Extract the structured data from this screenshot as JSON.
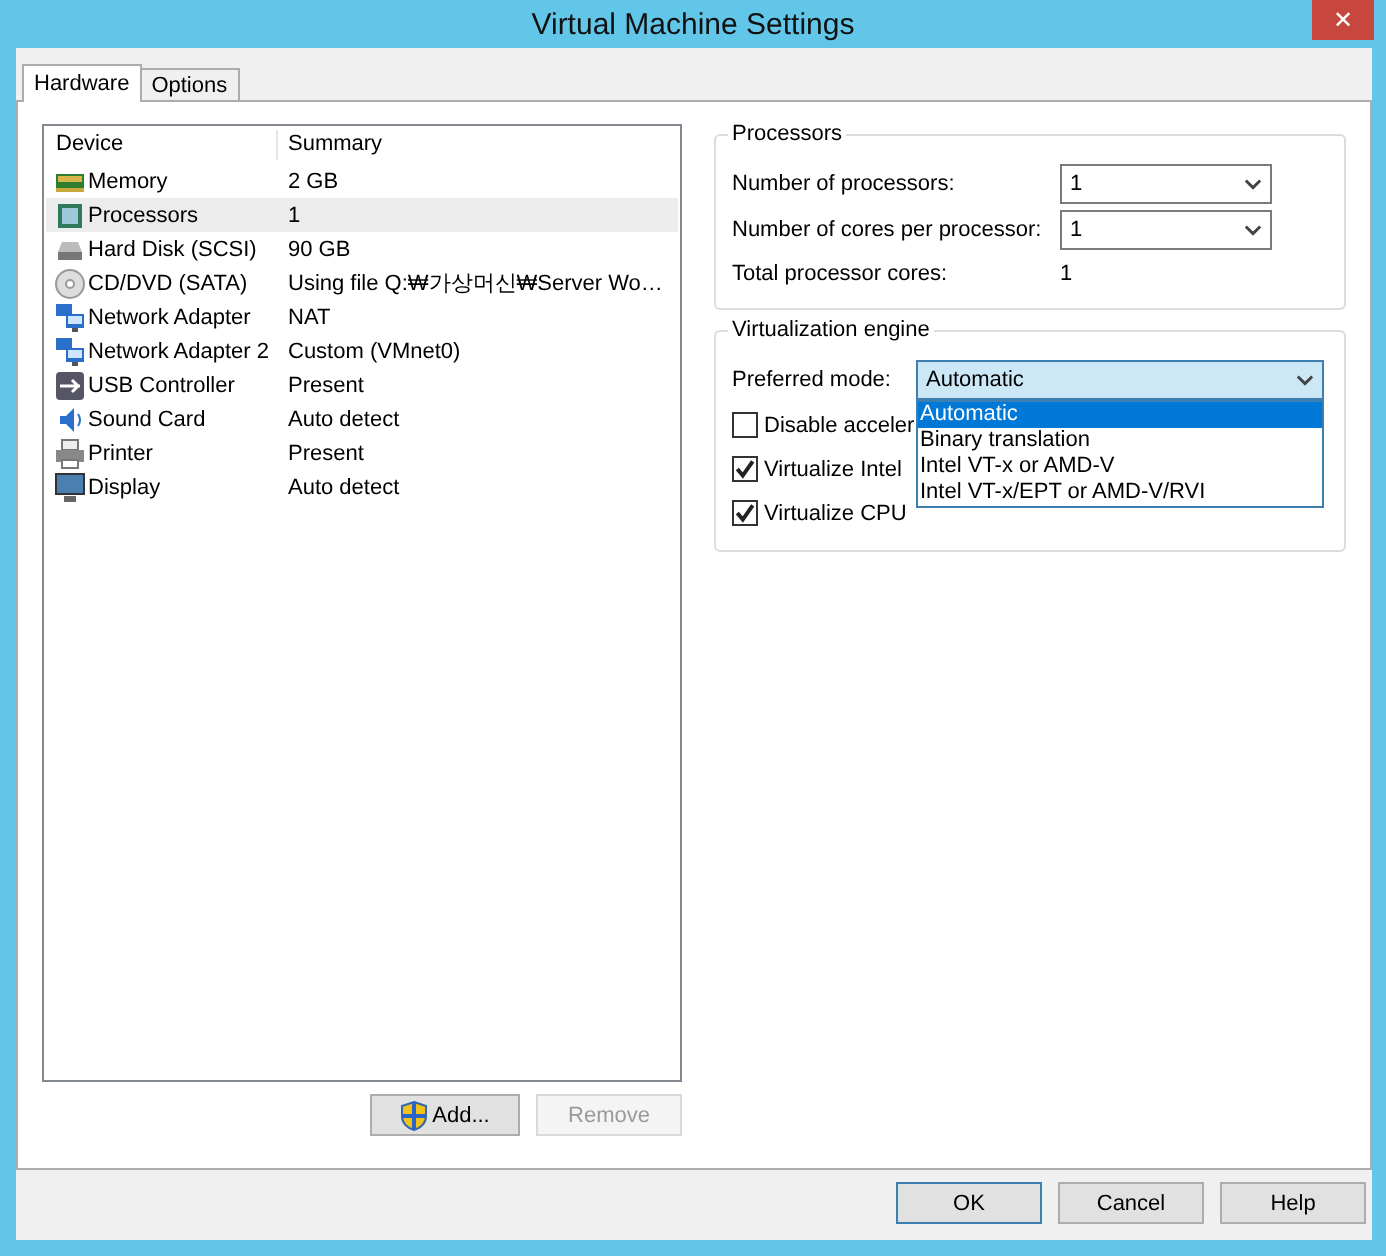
{
  "window": {
    "title": "Virtual Machine Settings",
    "close": "✕"
  },
  "tabs": [
    {
      "label": "Hardware",
      "selected": true
    },
    {
      "label": "Options",
      "selected": false
    }
  ],
  "devices": {
    "columns": [
      "Device",
      "Summary"
    ],
    "rows": [
      {
        "kind": "memory",
        "device": "Memory",
        "summary": "2 GB",
        "selected": false
      },
      {
        "kind": "processor",
        "device": "Processors",
        "summary": "1",
        "selected": true
      },
      {
        "kind": "disk",
        "device": "Hard Disk (SCSI)",
        "summary": "90 GB",
        "selected": false
      },
      {
        "kind": "cd",
        "device": "CD/DVD (SATA)",
        "summary": "Using file Q:₩가상머신₩Server Wo…",
        "selected": false
      },
      {
        "kind": "network",
        "device": "Network Adapter",
        "summary": "NAT",
        "selected": false
      },
      {
        "kind": "network",
        "device": "Network Adapter 2",
        "summary": "Custom (VMnet0)",
        "selected": false
      },
      {
        "kind": "usb",
        "device": "USB Controller",
        "summary": "Present",
        "selected": false
      },
      {
        "kind": "sound",
        "device": "Sound Card",
        "summary": "Auto detect",
        "selected": false
      },
      {
        "kind": "printer",
        "device": "Printer",
        "summary": "Present",
        "selected": false
      },
      {
        "kind": "display",
        "device": "Display",
        "summary": "Auto detect",
        "selected": false
      }
    ]
  },
  "list_buttons": [
    {
      "label": "Add...",
      "disabled": false,
      "shield": true
    },
    {
      "label": "Remove",
      "disabled": true,
      "shield": false
    }
  ],
  "processors": {
    "title": "Processors",
    "number_label": "Number of processors:",
    "number_value": "1",
    "cores_label": "Number of cores per processor:",
    "cores_value": "1",
    "total_label": "Total processor cores:",
    "total_value": "1"
  },
  "virtualization": {
    "title": "Virtualization engine",
    "mode_label": "Preferred mode:",
    "mode_value": "Automatic",
    "options": [
      {
        "label": "Automatic",
        "selected": true
      },
      {
        "label": "Binary translation",
        "selected": false
      },
      {
        "label": "Intel VT-x or AMD-V",
        "selected": false
      },
      {
        "label": "Intel VT-x/EPT or AMD-V/RVI",
        "selected": false
      }
    ],
    "checkboxes": [
      {
        "label": "Disable acceler",
        "checked": false
      },
      {
        "label": "Virtualize Intel",
        "checked": true
      },
      {
        "label": "Virtualize CPU",
        "checked": true
      }
    ]
  },
  "buttons": [
    {
      "label": "OK",
      "default": true
    },
    {
      "label": "Cancel",
      "default": false
    },
    {
      "label": "Help",
      "default": false
    }
  ]
}
